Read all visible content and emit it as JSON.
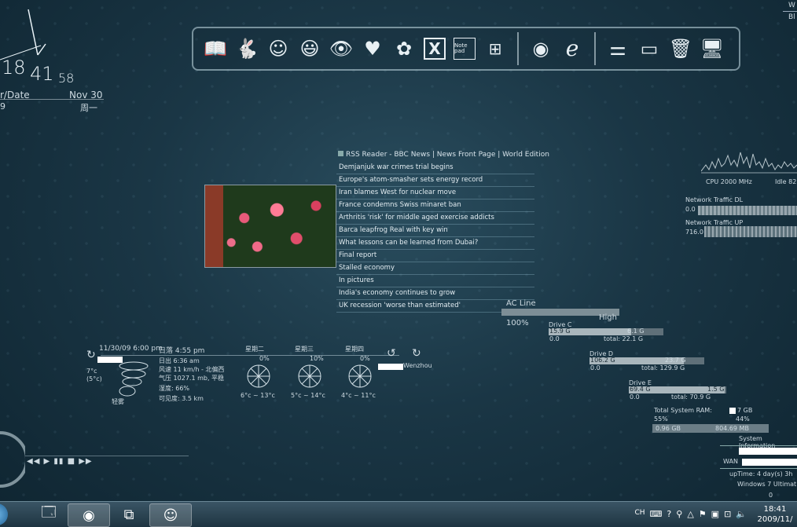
{
  "clock": {
    "hour": "18",
    "minute": "41",
    "second": "58",
    "label_left": "r/Date",
    "date": "Nov 30",
    "digit": "9",
    "weekday": "周一"
  },
  "dock": {
    "icons": [
      "book-icon",
      "rabbit-icon",
      "chat-icon",
      "smiley-icon",
      "eye-icon",
      "heart-v-icon",
      "flower-icon",
      "excel-icon",
      "notepad-icon",
      "calculator-icon",
      "firefox-icon",
      "ie-icon",
      "equalizer-icon",
      "monitor-icon",
      "trash-icon",
      "display-icon"
    ],
    "notepad_label": "Note pad"
  },
  "rss": {
    "title": "RSS Reader - BBC News | News Front Page | World Edition",
    "items": [
      "Demjanjuk war crimes trial begins",
      "Europe's atom-smasher sets energy record",
      "Iran blames West for nuclear move",
      "France condemns Swiss minaret ban",
      "Arthritis 'risk' for middle aged exercise addicts",
      "Barca leapfrog Real with key win",
      "What lessons can be learned from Dubai?",
      "Final report",
      "Stalled economy",
      "In pictures",
      "India's economy continues to grow",
      "UK recession 'worse than estimated'"
    ]
  },
  "weather": {
    "datetime": "11/30/09 6:00 pm",
    "sunset_label": "日落",
    "sunset": "4:55 pm",
    "sunrise_label": "日出",
    "sunrise": "6:36 am",
    "wind_label": "风速",
    "wind": "11 km/h - 北偏西",
    "pressure_label": "气压",
    "pressure": "1027.1 mb, 平稳",
    "humidity_label": "湿度:",
    "humidity": "66%",
    "visibility_label": "可见度:",
    "visibility": "3.5 km",
    "temp": "7°c",
    "feels": "(5°c)",
    "condition": "轻雾",
    "city": "Wenzhou",
    "forecast": [
      {
        "day": "星期二",
        "precip": "0%",
        "range": "6°c ~ 13°c"
      },
      {
        "day": "星期三",
        "precip": "10%",
        "range": "5°c ~ 14°c"
      },
      {
        "day": "星期四",
        "precip": "0%",
        "range": "4°c ~ 11°c"
      }
    ]
  },
  "media": {
    "controls": "◀◀ ▶ ▮▮ ■ ▶▶"
  },
  "power": {
    "source": "AC Line",
    "percent": "100%",
    "level": "High"
  },
  "drives": [
    {
      "name": "Drive C",
      "used": "15.9 G",
      "free": "6.1 G",
      "min": "0.0",
      "total": "total: 22.1 G",
      "fill": 0.72
    },
    {
      "name": "Drive D",
      "used": "106.2 G",
      "free": "23.7 G",
      "min": "0.0",
      "total": "total: 129.9 G",
      "fill": 0.82
    },
    {
      "name": "Drive E",
      "used": "69.4 G",
      "free": "1.5 G",
      "min": "0.0",
      "total": "total: 70.9 G",
      "fill": 0.98
    }
  ],
  "ram": {
    "label": "Total System RAM:",
    "total_suffix": "7 GB",
    "pct1": "55%",
    "pct2": "44%",
    "used": "0.96 GB",
    "free": "804.69 MB"
  },
  "cpu": {
    "freq": "CPU 2000 MHz",
    "idle": "Idle 82"
  },
  "network": {
    "dl_label": "Network Traffic DL",
    "dl_value": "0.0",
    "ul_label": "Network Traffic UP",
    "ul_value": "716.0"
  },
  "sysinfo": {
    "title": "System Information",
    "wan_label": "WAN",
    "uptime": "upTime: 4 day(s) 3h",
    "os": "Windows 7 Ultimat",
    "zero": "0"
  },
  "topright": {
    "line1": "W",
    "line2": "Bl"
  },
  "taskbar": {
    "lang": "CH",
    "time": "18:41",
    "date": "2009/11/"
  }
}
